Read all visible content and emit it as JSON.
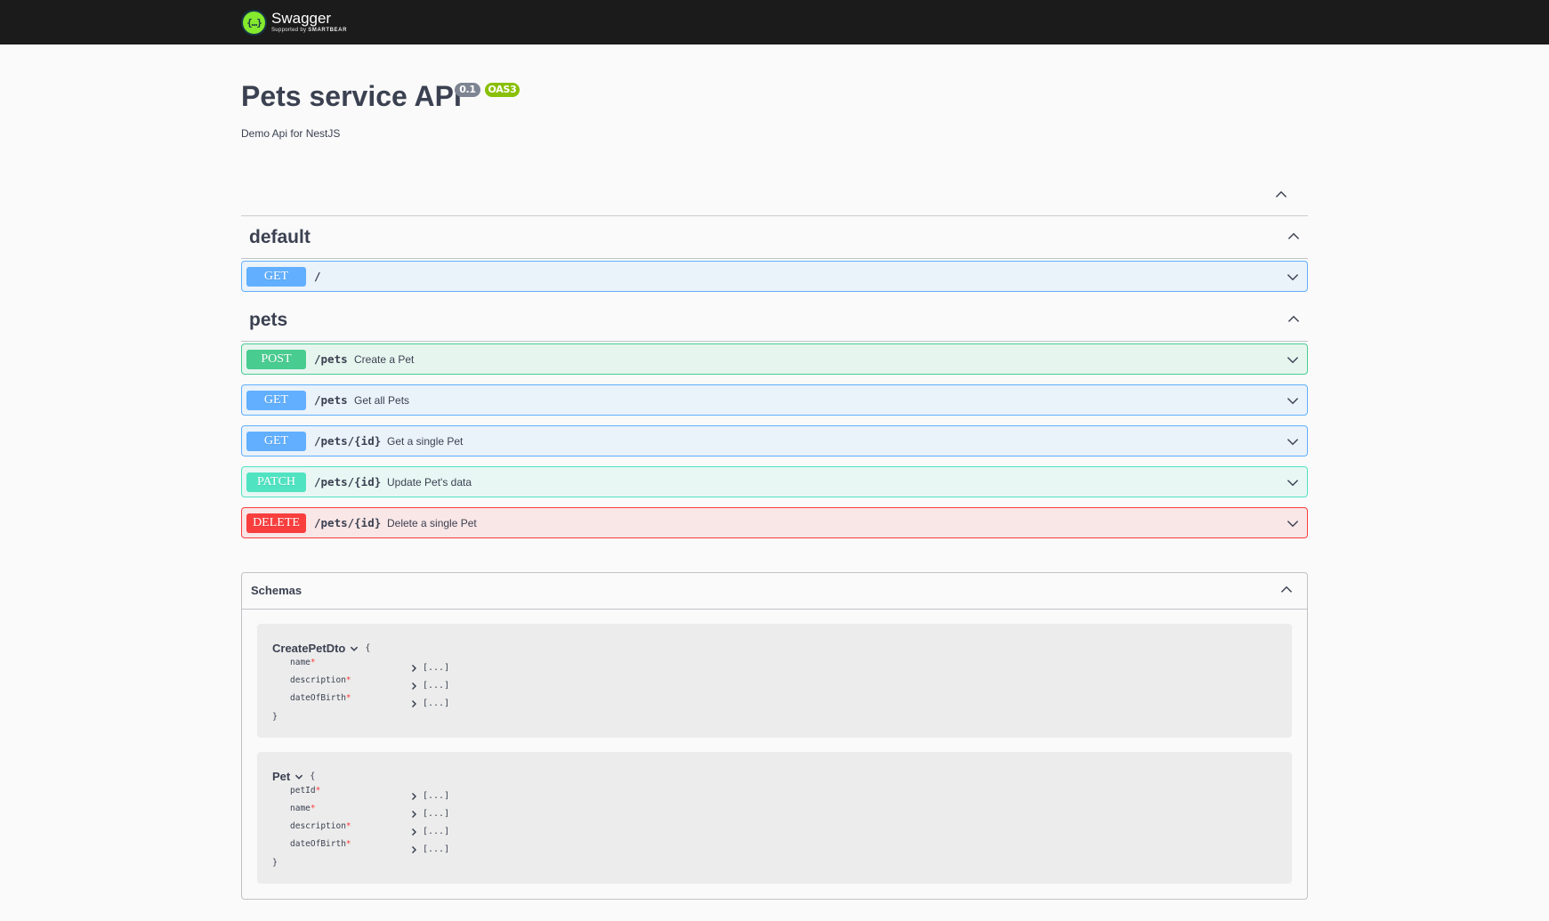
{
  "brand": {
    "logo_icon": "swagger-logo-icon",
    "logo_mark": "{…}",
    "name": "Swagger",
    "tagline_prefix": "Supported by",
    "tagline_company": "SMARTBEAR"
  },
  "info": {
    "title": "Pets service API",
    "version": "0.1",
    "oas": "OAS3",
    "description": "Demo Api for NestJS"
  },
  "tags": [
    {
      "name": "default",
      "operations": [
        {
          "method": "GET",
          "path": "/",
          "summary": ""
        }
      ]
    },
    {
      "name": "pets",
      "operations": [
        {
          "method": "POST",
          "path": "/pets",
          "summary": "Create a Pet"
        },
        {
          "method": "GET",
          "path": "/pets",
          "summary": "Get all Pets"
        },
        {
          "method": "GET",
          "path": "/pets/{id}",
          "summary": "Get a single Pet"
        },
        {
          "method": "PATCH",
          "path": "/pets/{id}",
          "summary": "Update Pet's data"
        },
        {
          "method": "DELETE",
          "path": "/pets/{id}",
          "summary": "Delete a single Pet"
        }
      ]
    }
  ],
  "schemas": {
    "title": "Schemas",
    "models": [
      {
        "name": "CreatePetDto",
        "open_brace": "{",
        "close_brace": "}",
        "properties": [
          {
            "name": "name",
            "required": "*",
            "value": "[...]"
          },
          {
            "name": "description",
            "required": "*",
            "value": "[...]"
          },
          {
            "name": "dateOfBirth",
            "required": "*",
            "value": "[...]"
          }
        ]
      },
      {
        "name": "Pet",
        "open_brace": "{",
        "close_brace": "}",
        "properties": [
          {
            "name": "petId",
            "required": "*",
            "value": "[...]"
          },
          {
            "name": "name",
            "required": "*",
            "value": "[...]"
          },
          {
            "name": "description",
            "required": "*",
            "value": "[...]"
          },
          {
            "name": "dateOfBirth",
            "required": "*",
            "value": "[...]"
          }
        ]
      }
    ]
  },
  "colors": {
    "get": "#61affe",
    "post": "#49cc90",
    "patch": "#50e3c2",
    "delete": "#f93e3e",
    "topbar": "#1b1b1b",
    "oas_badge": "#89bf04",
    "version_badge": "#7d8492"
  }
}
